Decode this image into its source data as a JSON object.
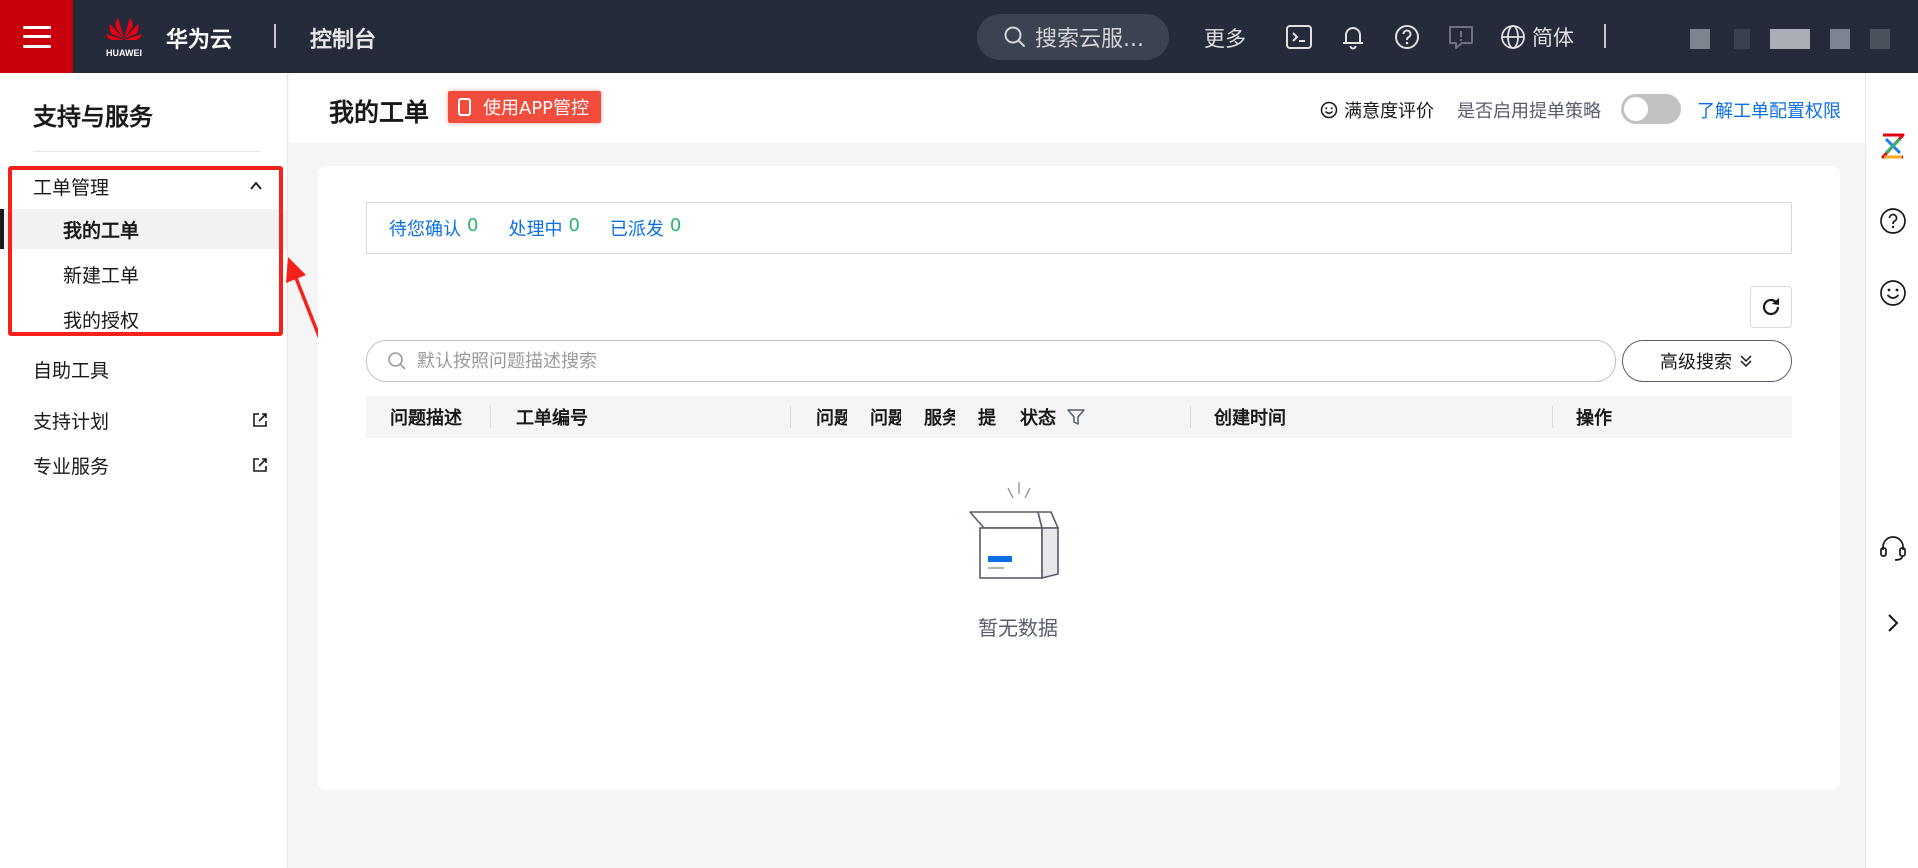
{
  "topbar": {
    "brand": "华为云",
    "logo_text": "HUAWEI",
    "console": "控制台",
    "search_placeholder": "搜索云服...",
    "more": "更多",
    "lang": "简体"
  },
  "sidebar": {
    "title": "支持与服务",
    "group": {
      "label": "工单管理",
      "items": [
        "我的工单",
        "新建工单",
        "我的授权"
      ],
      "active_index": 0
    },
    "items": [
      {
        "label": "自助工具",
        "external": false
      },
      {
        "label": "支持计划",
        "external": true
      },
      {
        "label": "专业服务",
        "external": true
      }
    ]
  },
  "header": {
    "title": "我的工单",
    "app_button": "使用APP管控",
    "satisfaction": "满意度评价",
    "policy_label": "是否启用提单策略",
    "policy_enabled": false,
    "perm_link": "了解工单配置权限"
  },
  "tabs": [
    {
      "label": "待您确认",
      "count": "0"
    },
    {
      "label": "处理中",
      "count": "0"
    },
    {
      "label": "已派发",
      "count": "0"
    }
  ],
  "search": {
    "placeholder": "默认按照问题描述搜索",
    "advanced": "高级搜索"
  },
  "table": {
    "columns": [
      "问题描述",
      "工单编号",
      "问题",
      "问题",
      "服务",
      "提",
      "状态",
      "创建时间",
      "操作"
    ],
    "empty_text": "暂无数据"
  },
  "colors": {
    "topbar": "#252b3a",
    "brand_red": "#c7000b",
    "link_blue": "#0a6fe3",
    "count_green": "#2db372",
    "annotation_red": "#f5221b"
  }
}
